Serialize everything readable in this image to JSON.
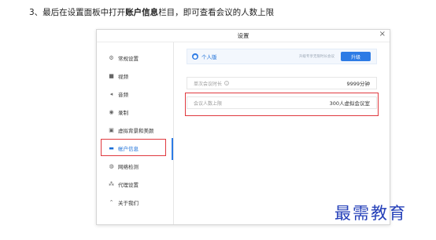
{
  "instruction": {
    "prefix": "3、最后在设置面板中打开",
    "bold": "账户信息",
    "suffix": "栏目，即可查看会议的人数上限"
  },
  "dialog": {
    "title": "设置",
    "close_glyph": "×"
  },
  "sidebar": {
    "items": [
      {
        "label": "常规设置",
        "icon": "gear-icon",
        "glyph": "⚙"
      },
      {
        "label": "视频",
        "icon": "video-icon",
        "glyph": "■"
      },
      {
        "label": "音频",
        "icon": "audio-icon",
        "glyph": "◂"
      },
      {
        "label": "录制",
        "icon": "record-icon",
        "glyph": "◉"
      },
      {
        "label": "虚拟背景和美颜",
        "icon": "background-icon",
        "glyph": "▣"
      },
      {
        "label": "帐户信息",
        "icon": "account-icon",
        "glyph": "▬"
      },
      {
        "label": "网络检测",
        "icon": "network-icon",
        "glyph": "◍"
      },
      {
        "label": "代理设置",
        "icon": "proxy-icon",
        "glyph": "⁂"
      },
      {
        "label": "关于我们",
        "icon": "about-icon",
        "glyph": "⌃"
      }
    ],
    "active_index": 5
  },
  "account": {
    "plan_label": "个人版",
    "upgrade_hint": "升级专享无限时长会议",
    "upgrade_button": "升级",
    "meeting_duration": {
      "label": "单次会议时长",
      "value": "9999分钟"
    },
    "participant_limit": {
      "label": "会议人数上限",
      "value": "300人虚拟会议室"
    }
  },
  "watermark": "最需教育",
  "colors": {
    "accent": "#2d7be5",
    "highlight": "#e0393e",
    "watermark": "#2540b9"
  }
}
